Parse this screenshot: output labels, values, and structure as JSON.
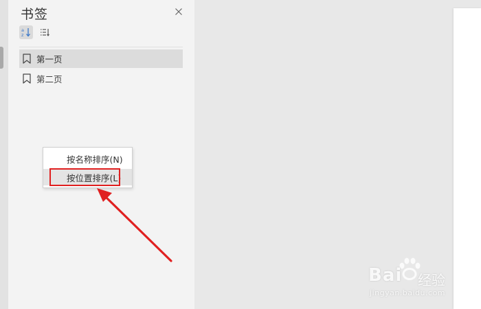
{
  "panel": {
    "title": "书签",
    "close_icon": "close-icon",
    "sort_buttons": [
      {
        "name": "sort-by-name-icon",
        "active": true
      },
      {
        "name": "sort-by-position-icon",
        "active": false
      }
    ]
  },
  "bookmarks": [
    {
      "label": "第一页",
      "selected": true
    },
    {
      "label": "第二页",
      "selected": false
    }
  ],
  "context_menu": {
    "items": [
      {
        "label": "按名称排序(N)"
      },
      {
        "label": "按位置排序(L)"
      }
    ]
  },
  "annotation": {
    "color": "#e02020"
  },
  "watermark": {
    "brand": "Bai",
    "brand_suffix": "经验",
    "url": "jingyan.baidu.com"
  },
  "colors": {
    "background": "#e8e8e8",
    "panel": "#f3f3f3",
    "selected_row": "#dcdcdc",
    "accent_blue": "#3b78c9"
  }
}
